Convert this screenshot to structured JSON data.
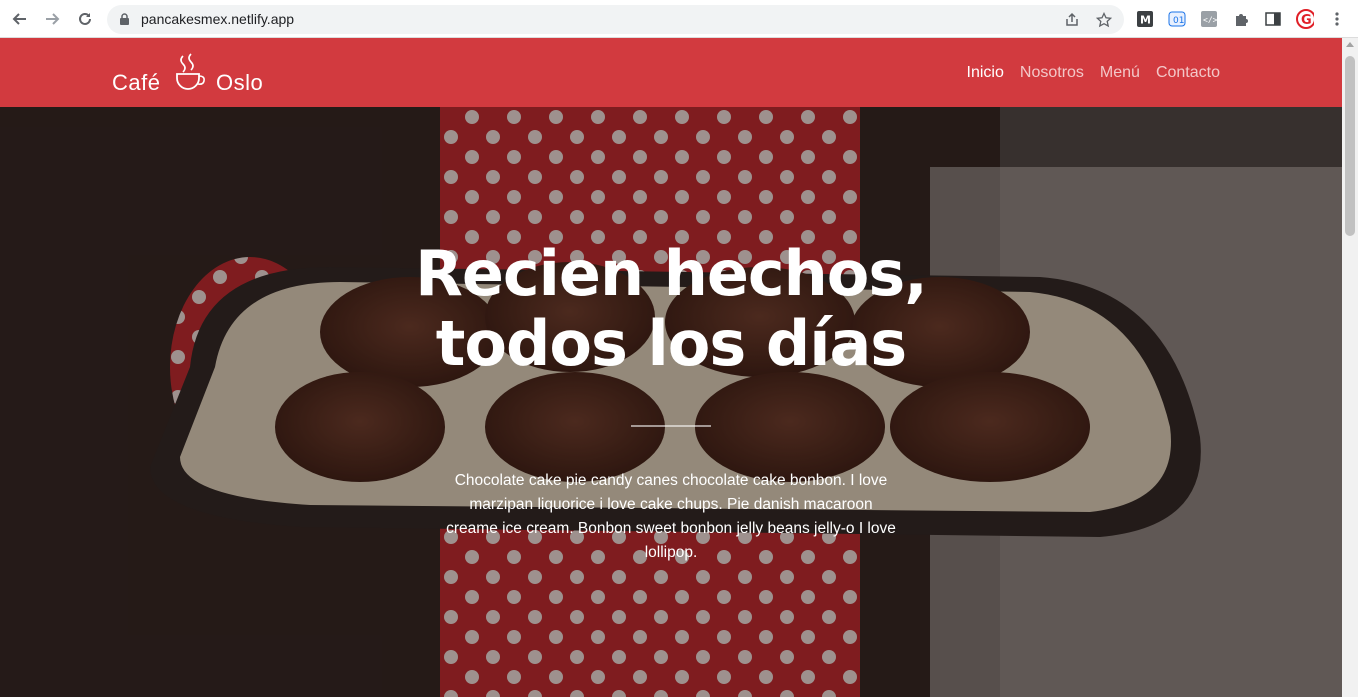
{
  "browser": {
    "url": "pancakesmex.netlify.app"
  },
  "site": {
    "logo_left": "Café",
    "logo_right": "Oslo",
    "nav": [
      {
        "label": "Inicio",
        "active": true
      },
      {
        "label": "Nosotros",
        "active": false
      },
      {
        "label": "Menú",
        "active": false
      },
      {
        "label": "Contacto",
        "active": false
      }
    ]
  },
  "hero": {
    "title_line1": "Recien hechos,",
    "title_line2": "todos los días",
    "description": "Chocolate cake pie candy canes chocolate cake bonbon. I love marzipan liquorice i love cake chups. Pie danish macaroon creame ice cream. Bonbon sweet bonbon jelly beans jelly-o I love lollipop."
  },
  "colors": {
    "navbar": "#d23a3f",
    "menu_inactive": "#f3c7c8",
    "menu_active": "#ffffff"
  }
}
